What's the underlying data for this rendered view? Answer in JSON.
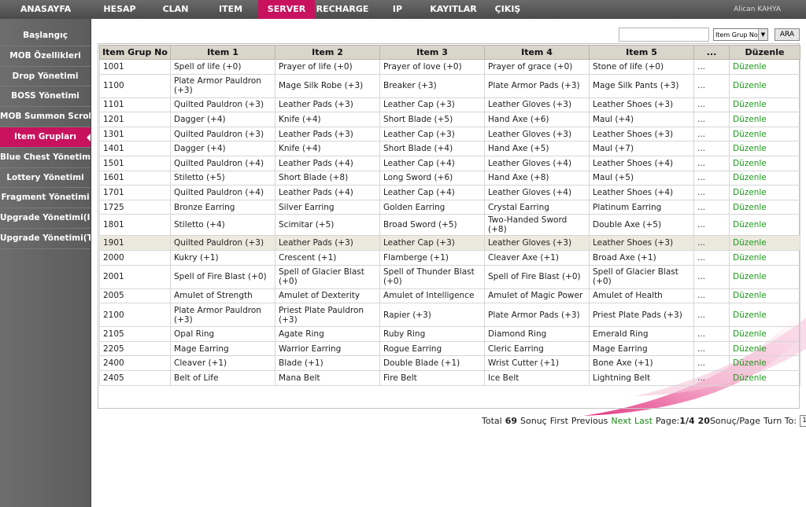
{
  "nav": {
    "items": [
      {
        "label": "ANASAYFA",
        "active": false
      },
      {
        "label": "HESAP",
        "active": false
      },
      {
        "label": "CLAN",
        "active": false
      },
      {
        "label": "ITEM",
        "active": false
      },
      {
        "label": "SERVER",
        "active": true
      },
      {
        "label": "RECHARGE",
        "active": false
      },
      {
        "label": "IP",
        "active": false
      },
      {
        "label": "KAYITLAR",
        "active": false
      },
      {
        "label": "ÇIKIŞ",
        "active": false
      }
    ],
    "user": "Alican KAHYA"
  },
  "sidebar": {
    "items": [
      {
        "label": "Başlangıç",
        "active": false
      },
      {
        "label": "MOB Özellikleri",
        "active": false
      },
      {
        "label": "Drop Yönetimi",
        "active": false
      },
      {
        "label": "BOSS Yönetimi",
        "active": false
      },
      {
        "label": "MOB Summon Scroll",
        "active": false
      },
      {
        "label": "Item Grupları",
        "active": true
      },
      {
        "label": "Blue Chest Yönetimi",
        "active": false
      },
      {
        "label": "Lottery Yönetimi",
        "active": false
      },
      {
        "label": "Fragment Yönetimi",
        "active": false
      },
      {
        "label": "Upgrade Yönetimi(I)",
        "active": false
      },
      {
        "label": "Upgrade Yönetimi(T)",
        "active": false
      }
    ]
  },
  "search": {
    "value": "",
    "select_value": "Item Grup No",
    "button_label": "ARA"
  },
  "table": {
    "headers": [
      "Item Grup No",
      "Item 1",
      "Item 2",
      "Item 3",
      "Item 4",
      "Item 5",
      "...",
      "Düzenle"
    ],
    "rows": [
      {
        "cells": [
          "1001",
          "Spell of life (+0)",
          "Prayer of life (+0)",
          "Prayer of love (+0)",
          "Prayer of grace (+0)",
          "Stone of life (+0)",
          "...",
          "Düzenle"
        ]
      },
      {
        "cells": [
          "1100",
          "Plate Armor Pauldron (+3)",
          "Mage Silk Robe (+3)",
          "Breaker (+3)",
          "Plate Armor Pads (+3)",
          "Mage Silk Pants (+3)",
          "...",
          "Düzenle"
        ],
        "tall": true
      },
      {
        "cells": [
          "1101",
          "Quilted Pauldron (+3)",
          "Leather Pads (+3)",
          "Leather Cap (+3)",
          "Leather Gloves (+3)",
          "Leather Shoes (+3)",
          "...",
          "Düzenle"
        ]
      },
      {
        "cells": [
          "1201",
          "Dagger (+4)",
          "Knife (+4)",
          "Short Blade (+5)",
          "Hand Axe (+6)",
          "Maul (+4)",
          "...",
          "Düzenle"
        ]
      },
      {
        "cells": [
          "1301",
          "Quilted Pauldron (+3)",
          "Leather Pads (+3)",
          "Leather Cap (+3)",
          "Leather Gloves (+3)",
          "Leather Shoes (+3)",
          "...",
          "Düzenle"
        ]
      },
      {
        "cells": [
          "1401",
          "Dagger (+4)",
          "Knife (+4)",
          "Short Blade (+4)",
          "Hand Axe (+5)",
          "Maul (+7)",
          "...",
          "Düzenle"
        ]
      },
      {
        "cells": [
          "1501",
          "Quilted Pauldron (+4)",
          "Leather Pads (+4)",
          "Leather Cap (+4)",
          "Leather Gloves (+4)",
          "Leather Shoes (+4)",
          "...",
          "Düzenle"
        ]
      },
      {
        "cells": [
          "1601",
          "Stiletto (+5)",
          "Short Blade (+8)",
          "Long Sword (+6)",
          "Hand Axe (+8)",
          "Maul (+5)",
          "...",
          "Düzenle"
        ]
      },
      {
        "cells": [
          "1701",
          "Quilted Pauldron (+4)",
          "Leather Pads (+4)",
          "Leather Cap (+4)",
          "Leather Gloves (+4)",
          "Leather Shoes (+4)",
          "...",
          "Düzenle"
        ]
      },
      {
        "cells": [
          "1725",
          "Bronze Earring",
          "Silver Earring",
          "Golden Earring",
          "Crystal Earring",
          "Platinum Earring",
          "...",
          "Düzenle"
        ]
      },
      {
        "cells": [
          "1801",
          "Stiletto (+4)",
          "Scimitar (+5)",
          "Broad Sword (+5)",
          "Two-Handed Sword (+8)",
          "Double Axe (+5)",
          "...",
          "Düzenle"
        ]
      },
      {
        "cells": [
          "1901",
          "Quilted Pauldron (+3)",
          "Leather Pads (+3)",
          "Leather Cap (+3)",
          "Leather Gloves (+3)",
          "Leather Shoes (+3)",
          "...",
          "Düzenle"
        ],
        "highlight": true
      },
      {
        "cells": [
          "2000",
          "Kukry (+1)",
          "Crescent (+1)",
          "Flamberge (+1)",
          "Cleaver Axe (+1)",
          "Broad Axe (+1)",
          "...",
          "Düzenle"
        ]
      },
      {
        "cells": [
          "2001",
          "Spell of Fire Blast (+0)",
          "Spell of Glacier Blast (+0)",
          "Spell of Thunder Blast (+0)",
          "Spell of Fire Blast (+0)",
          "Spell of Glacier Blast (+0)",
          "...",
          "Düzenle"
        ],
        "tall": true
      },
      {
        "cells": [
          "2005",
          "Amulet of Strength",
          "Amulet of Dexterity",
          "Amulet of Intelligence",
          "Amulet of Magic Power",
          "Amulet of Health",
          "...",
          "Düzenle"
        ]
      },
      {
        "cells": [
          "2100",
          "Plate Armor Pauldron (+3)",
          "Priest Plate Pauldron (+3)",
          "Rapier (+3)",
          "Plate Armor Pads (+3)",
          "Priest Plate Pads (+3)",
          "...",
          "Düzenle"
        ],
        "tall": true
      },
      {
        "cells": [
          "2105",
          "Opal Ring",
          "Agate Ring",
          "Ruby Ring",
          "Diamond Ring",
          "Emerald Ring",
          "...",
          "Düzenle"
        ]
      },
      {
        "cells": [
          "2205",
          "Mage Earring",
          "Warrior Earring",
          "Rogue Earring",
          "Cleric Earring",
          "Mage Earring",
          "...",
          "Düzenle"
        ]
      },
      {
        "cells": [
          "2400",
          "Cleaver (+1)",
          "Blade (+1)",
          "Double Blade (+1)",
          "Wrist Cutter (+1)",
          "Bone Axe (+1)",
          "...",
          "Düzenle"
        ]
      },
      {
        "cells": [
          "2405",
          "Belt of Life",
          "Mana Belt",
          "Fire Belt",
          "Ice Belt",
          "Lightning Belt",
          "...",
          "Düzenle"
        ]
      }
    ]
  },
  "pager": {
    "total_label": "Total",
    "total_count": "69",
    "result_label": "Sonuç",
    "first": "First",
    "previous": "Previous",
    "next": "Next",
    "last": "Last",
    "page_label": "Page:",
    "page_value": "1/4",
    "per_page": "20",
    "per_page_label": "Sonuç/Page",
    "turn_to": "Turn To:",
    "turn_value": "1"
  },
  "colors": {
    "accent": "#c8125e",
    "link_green": "#1a9a1a"
  }
}
